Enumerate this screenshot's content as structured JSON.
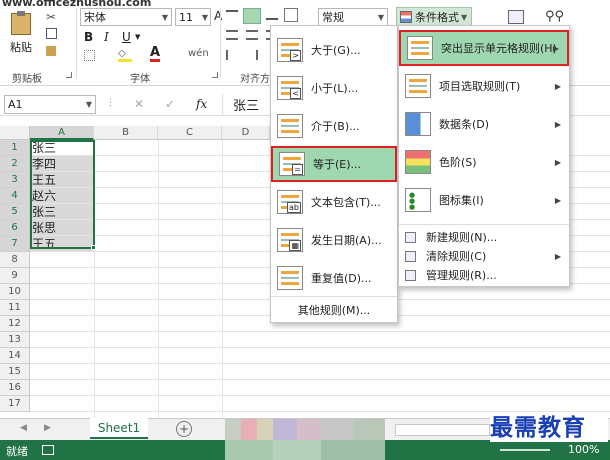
{
  "watermark_url": "www.officezhushou.com",
  "ribbon": {
    "paste_label": "粘贴",
    "clipboard_group": "剪贴板",
    "font_name": "宋体",
    "font_size": "11",
    "font_group": "字体",
    "bold": "B",
    "italic": "I",
    "underline": "U",
    "font_color_letter": "A",
    "grow_font": "A",
    "align_group": "对齐方",
    "number_format": "常规",
    "cond_format_label": "条件格式"
  },
  "formula_bar": {
    "name_box": "A1",
    "fx": "fx",
    "value": "张三"
  },
  "columns": [
    "A",
    "B",
    "C",
    "D"
  ],
  "rows": [
    "1",
    "2",
    "3",
    "4",
    "5",
    "6",
    "7",
    "8",
    "9",
    "10",
    "11",
    "12",
    "13",
    "14",
    "15",
    "16",
    "17"
  ],
  "cells_a": [
    "张三",
    "李四",
    "王五",
    "赵六",
    "张三",
    "张思",
    "王五"
  ],
  "submenu": {
    "items": [
      {
        "label": "大于(G)..."
      },
      {
        "label": "小于(L)..."
      },
      {
        "label": "介于(B)..."
      },
      {
        "label": "等于(E)..."
      },
      {
        "label": "文本包含(T)..."
      },
      {
        "label": "发生日期(A)..."
      },
      {
        "label": "重复值(D)..."
      }
    ],
    "more_rules": "其他规则(M)..."
  },
  "mainmenu": {
    "items": [
      {
        "label": "突出显示单元格规则(H)"
      },
      {
        "label": "项目选取规则(T)"
      },
      {
        "label": "数据条(D)"
      },
      {
        "label": "色阶(S)"
      },
      {
        "label": "图标集(I)"
      }
    ],
    "small_items": [
      {
        "label": "新建规则(N)..."
      },
      {
        "label": "清除规则(C)"
      },
      {
        "label": "管理规则(R)..."
      }
    ]
  },
  "sheet_tab": "Sheet1",
  "status": {
    "ready": "就绪",
    "zoom": "100%"
  },
  "logo_text": "最需教育",
  "colors": {
    "excel_green": "#217346",
    "highlight": "#9fd7b0",
    "red_frame": "#dd2222"
  }
}
